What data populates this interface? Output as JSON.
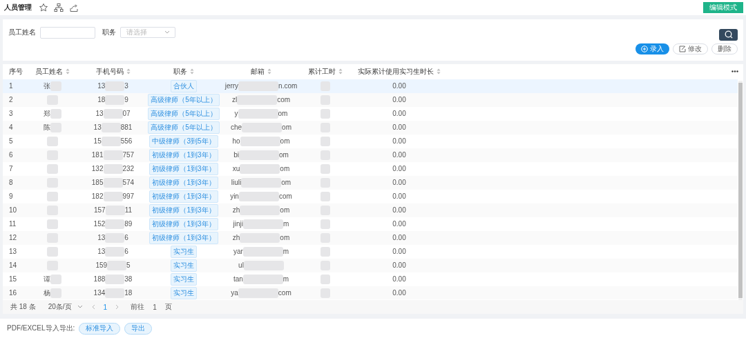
{
  "page": {
    "title": "人员管理",
    "mode_button": "编辑模式"
  },
  "filters": [
    {
      "label": "员工姓名",
      "kind": "text"
    },
    {
      "label": "职务",
      "kind": "select",
      "placeholder": "请选择"
    }
  ],
  "actions": [
    {
      "label": "录入",
      "kind": "primary"
    },
    {
      "label": "修改",
      "kind": "edit"
    },
    {
      "label": "删除",
      "kind": "plain"
    }
  ],
  "table": {
    "columns": [
      "序号",
      "员工姓名",
      "手机号码",
      "职务",
      "邮箱",
      "累计工时",
      "实际累计使用实习生时长"
    ],
    "rows": [
      {
        "index": "1",
        "name_start": "张",
        "phone_start": "13",
        "phone_end": "3",
        "role": "合伙人",
        "email_start": "jerry",
        "email_end": "n.com",
        "hours_left": "0.00",
        "selected": true
      },
      {
        "index": "2",
        "phone_start": "18",
        "phone_end": "9",
        "role": "高级律师（5年以上）",
        "email_start": "zl",
        "email_end": "com",
        "hours_left": "0.00",
        "selected": false
      },
      {
        "index": "3",
        "name_start": "郑",
        "phone_start": "13",
        "phone_end": "07",
        "role": "高级律师（5年以上）",
        "email_start": "y",
        "email_end": "om",
        "hours_left": "0.00",
        "selected": false
      },
      {
        "index": "4",
        "name_start": "陈",
        "phone_start": "13",
        "phone_end": "881",
        "role": "高级律师（5年以上）",
        "email_start": "che",
        "email_end": "om",
        "hours_left": "0.00",
        "selected": false
      },
      {
        "index": "5",
        "phone_start": "15",
        "phone_end": "556",
        "role": "中级律师（3到5年）",
        "email_start": "ho",
        "email_end": "om",
        "hours_left": "0.00",
        "selected": false
      },
      {
        "index": "6",
        "phone_start": "181",
        "phone_end": "757",
        "role": "初级律师（1到3年）",
        "email_start": "bi",
        "email_end": "om",
        "hours_left": "0.00",
        "selected": false
      },
      {
        "index": "7",
        "phone_start": "132",
        "phone_end": "232",
        "role": "初级律师（1到3年）",
        "email_start": "xu",
        "email_end": "om",
        "hours_left": "0.00",
        "selected": false
      },
      {
        "index": "8",
        "phone_start": "185",
        "phone_end": "574",
        "role": "初级律师（1到3年）",
        "email_start": "liuli",
        "email_end": "om",
        "hours_left": "0.00",
        "selected": false
      },
      {
        "index": "9",
        "phone_start": "182",
        "phone_end": "997",
        "role": "初级律师（1到3年）",
        "email_start": "yin",
        "email_end": "com",
        "hours_left": "0.00",
        "selected": false
      },
      {
        "index": "10",
        "phone_start": "157",
        "phone_end": "11",
        "role": "初级律师（1到3年）",
        "email_start": "zh",
        "email_end": "om",
        "hours_left": "0.00",
        "selected": false
      },
      {
        "index": "11",
        "phone_start": "152",
        "phone_end": "89",
        "role": "初级律师（1到3年）",
        "email_start": "jinji",
        "email_end": "m",
        "hours_left": "0.00",
        "selected": false
      },
      {
        "index": "12",
        "phone_start": "13",
        "phone_end": "6",
        "role": "初级律师（1到3年）",
        "email_start": "zh",
        "email_end": "om",
        "hours_left": "0.00",
        "selected": false
      },
      {
        "index": "13",
        "phone_start": "13",
        "phone_end": "6",
        "role": "实习生",
        "email_start": "yar",
        "email_end": "m",
        "hours_left": "0.00",
        "selected": false
      },
      {
        "index": "14",
        "phone_start": "159",
        "phone_end": "5",
        "role": "实习生",
        "email_start": "ul",
        "hours_left": "0.00",
        "selected": false
      },
      {
        "index": "15",
        "name_start": "谭",
        "phone_start": "188",
        "phone_end": "38",
        "role": "实习生",
        "email_start": "tan",
        "email_end": "m",
        "hours_left": "0.00",
        "selected": false
      },
      {
        "index": "16",
        "name_start": "杨",
        "phone_start": "134",
        "phone_end": "18",
        "role": "实习生",
        "email_start": "ya",
        "email_end": "com",
        "hours_left": "0.00",
        "selected": false
      }
    ]
  },
  "pagination": {
    "total": "共 18 条",
    "page_size": "20条/页",
    "current_page": "1",
    "goto_label": "前往",
    "goto_value": "1",
    "goto_unit": "页"
  },
  "footer": {
    "label": "PDF/EXCEL导入导出:",
    "buttons": [
      "标准导入",
      "导出"
    ]
  }
}
